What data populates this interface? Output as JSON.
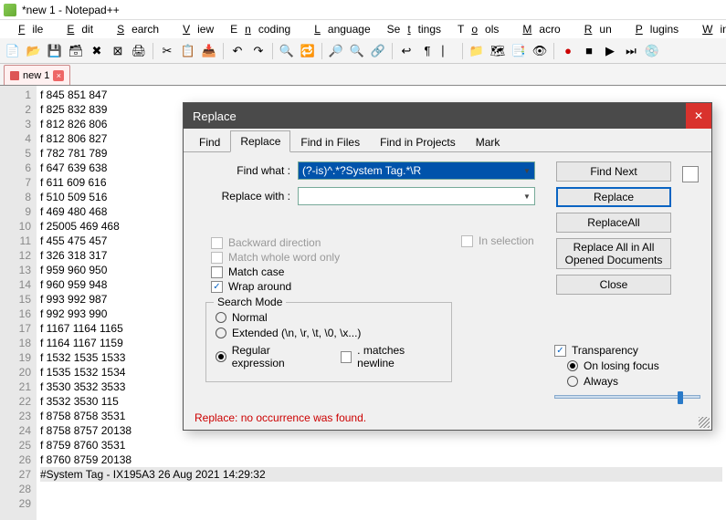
{
  "window": {
    "title": "*new 1 - Notepad++"
  },
  "menu": [
    "File",
    "Edit",
    "Search",
    "View",
    "Encoding",
    "Language",
    "Settings",
    "Tools",
    "Macro",
    "Run",
    "Plugins",
    "Window",
    "?"
  ],
  "fileTab": {
    "label": "new 1"
  },
  "lines": [
    "f 845 851 847",
    "f 825 832 839",
    "f 812 826 806",
    "f 812 806 827",
    "f 782 781 789",
    "f 647 639 638",
    "f 611 609 616",
    "f 510 509 516",
    "f 469 480 468",
    "f 25005 469 468",
    "f 455 475 457",
    "f 326 318 317",
    "f 959 960 950",
    "f 960 959 948",
    "f 993 992 987",
    "f 992 993 990",
    "f 1167 1164 1165",
    "f 1164 1167 1159",
    "f 1532 1535 1533",
    "f 1535 1532 1534",
    "f 3530 3532 3533",
    "f 3532 3530 115",
    "f 8758 8758 3531",
    "f 8758 8757 20138",
    "f 8759 8760 3531",
    "f 8760 8759 20138",
    "",
    "",
    "#System Tag - IX195A3 26 Aug 2021 14:29:32"
  ],
  "dialog": {
    "title": "Replace",
    "tabs": [
      "Find",
      "Replace",
      "Find in Files",
      "Find in Projects",
      "Mark"
    ],
    "activeTab": 1,
    "findLabel": "Find what :",
    "replaceLabel": "Replace with :",
    "findValue": "(?-is)^.*?System Tag.*\\R",
    "replaceValue": "",
    "inSelection": "In selection",
    "buttons": {
      "findNext": "Find Next",
      "replace": "Replace",
      "replaceAll": "Replace All",
      "replaceAllOpened": "Replace All in All Opened Documents",
      "close": "Close"
    },
    "opts": {
      "backward": "Backward direction",
      "wholeWord": "Match whole word only",
      "matchCase": "Match case",
      "wrap": "Wrap around"
    },
    "searchMode": {
      "legend": "Search Mode",
      "normal": "Normal",
      "extended": "Extended (\\n, \\r, \\t, \\0, \\x...)",
      "regex": "Regular expression",
      "dotNewline": ". matches newline"
    },
    "transparency": {
      "label": "Transparency",
      "onLosing": "On losing focus",
      "always": "Always"
    },
    "status": "Replace: no occurrence was found."
  }
}
